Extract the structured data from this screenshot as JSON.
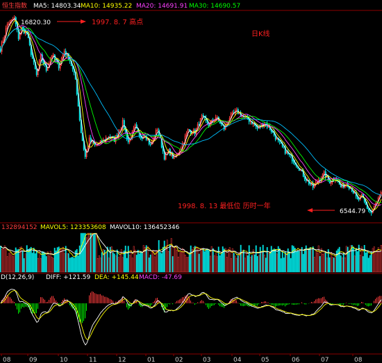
{
  "chart_data": [
    {
      "type": "candlestick",
      "header": {
        "symbol": "恒生指数",
        "ma5": "MA5: 14803.34",
        "ma10": "MA10: 14935.22",
        "ma20": "MA20: 14691.91",
        "ma30": "MA30: 14690.57"
      },
      "annotations": {
        "high_value": "16820.30",
        "high_note": "1997. 8. 7 高点",
        "period": "日K线",
        "low_note": "1998. 8. 13 最低位 历时一年",
        "low_value": "6544.79"
      },
      "x_ticks": [
        "08",
        "09",
        "10",
        "11",
        "12",
        "01",
        "02",
        "03",
        "04",
        "05",
        "06",
        "07",
        "08"
      ],
      "close_keypoints": [
        [
          0,
          15200
        ],
        [
          10,
          16500
        ],
        [
          20,
          16820
        ],
        [
          26,
          15800
        ],
        [
          30,
          16300
        ],
        [
          38,
          16000
        ],
        [
          44,
          15000
        ],
        [
          52,
          13800
        ],
        [
          58,
          14800
        ],
        [
          66,
          14100
        ],
        [
          74,
          14900
        ],
        [
          84,
          14300
        ],
        [
          92,
          15100
        ],
        [
          100,
          14600
        ],
        [
          108,
          13600
        ],
        [
          116,
          10800
        ],
        [
          122,
          9500
        ],
        [
          128,
          10400
        ],
        [
          136,
          10100
        ],
        [
          146,
          10300
        ],
        [
          156,
          10600
        ],
        [
          164,
          10400
        ],
        [
          176,
          11300
        ],
        [
          184,
          10300
        ],
        [
          194,
          11100
        ],
        [
          200,
          10500
        ],
        [
          208,
          10700
        ],
        [
          216,
          10100
        ],
        [
          226,
          11000
        ],
        [
          236,
          9500
        ],
        [
          242,
          9800
        ],
        [
          250,
          9400
        ],
        [
          260,
          10000
        ],
        [
          270,
          10900
        ],
        [
          280,
          10800
        ],
        [
          290,
          11600
        ],
        [
          300,
          11200
        ],
        [
          310,
          11600
        ],
        [
          322,
          11000
        ],
        [
          330,
          11600
        ],
        [
          340,
          11900
        ],
        [
          350,
          11600
        ],
        [
          360,
          11400
        ],
        [
          370,
          11000
        ],
        [
          380,
          11300
        ],
        [
          390,
          10900
        ],
        [
          400,
          10300
        ],
        [
          410,
          9800
        ],
        [
          420,
          9400
        ],
        [
          430,
          8900
        ],
        [
          440,
          8300
        ],
        [
          450,
          7900
        ],
        [
          458,
          8300
        ],
        [
          466,
          8600
        ],
        [
          474,
          8200
        ],
        [
          482,
          8400
        ],
        [
          490,
          7900
        ],
        [
          498,
          8100
        ],
        [
          506,
          7800
        ],
        [
          514,
          7200
        ],
        [
          520,
          7400
        ],
        [
          528,
          6800
        ],
        [
          534,
          6545
        ],
        [
          540,
          7000
        ],
        [
          549,
          7600
        ]
      ]
    },
    {
      "type": "bar",
      "header": {
        "vol": "132894152",
        "mavol5": "MAVOL5: 123353608",
        "mavol10": "MAVOL10: 136452346"
      }
    },
    {
      "type": "macd",
      "header": {
        "name": "D(12,26,9)",
        "diff": "DIFF: +121.59",
        "dea": "DEA: +145.44",
        "macd": "MACD: -47.69"
      }
    }
  ],
  "colors": {
    "up": "#ff3c3c",
    "down": "#00e0e0",
    "ma5": "#ffffff",
    "ma10": "#ffff00",
    "ma20": "#ff40ff",
    "ma30": "#00ff00",
    "ma60": "#00c0ff",
    "grid": "#8b0000",
    "annotation": "#ff2020",
    "tick": "#d0d0d0"
  }
}
